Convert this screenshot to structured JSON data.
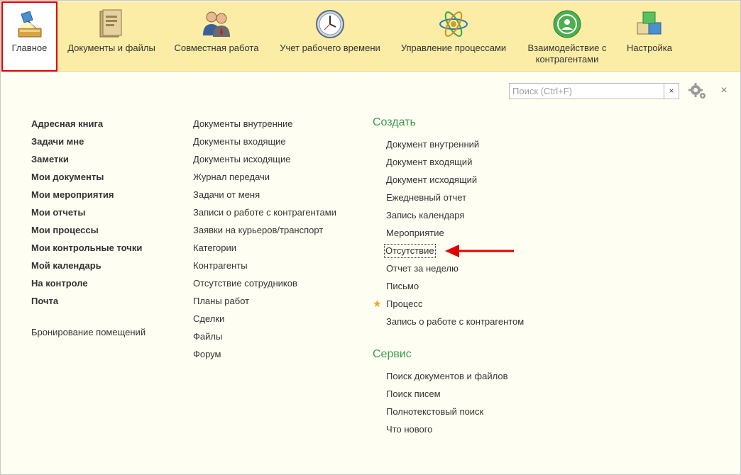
{
  "sections": [
    {
      "label": "Главное",
      "icon": "main-desk-lamp-icon",
      "active": true
    },
    {
      "label": "Документы и файлы",
      "icon": "documents-folder-icon"
    },
    {
      "label": "Совместная работа",
      "icon": "collaboration-people-icon"
    },
    {
      "label": "Учет рабочего времени",
      "icon": "clock-icon"
    },
    {
      "label": "Управление процессами",
      "icon": "process-atom-icon"
    },
    {
      "label": "Взаимодействие с",
      "label2": "контрагентами",
      "icon": "interaction-cycle-icon"
    },
    {
      "label": "Настройка",
      "icon": "settings-cubes-icon"
    }
  ],
  "search": {
    "placeholder": "Поиск (Ctrl+F)",
    "clear": "×"
  },
  "close_label": "×",
  "column1": {
    "bold_items": [
      "Адресная книга",
      "Задачи мне",
      "Заметки",
      "Мои документы",
      "Мои мероприятия",
      "Мои отчеты",
      "Мои процессы",
      "Мои контрольные точки",
      "Мой календарь",
      "На контроле",
      "Почта"
    ],
    "extra_item": "Бронирование помещений"
  },
  "column2": {
    "items": [
      "Документы внутренние",
      "Документы входящие",
      "Документы исходящие",
      "Журнал передачи",
      "Задачи от меня",
      "Записи о работе с контрагентами",
      "Заявки на курьеров/транспорт",
      "Категории",
      "Контрагенты",
      "Отсутствие сотрудников",
      "Планы работ",
      "Сделки",
      "Файлы",
      "Форум"
    ]
  },
  "create": {
    "title": "Создать",
    "items": [
      "Документ внутренний",
      "Документ входящий",
      "Документ исходящий",
      "Ежедневный отчет",
      "Запись календаря",
      "Мероприятие",
      "Отсутствие",
      "Отчет за неделю",
      "Письмо",
      "Процесс",
      "Запись о работе с контрагентом"
    ]
  },
  "service": {
    "title": "Сервис",
    "items": [
      "Поиск документов и файлов",
      "Поиск писем",
      "Полнотекстовый поиск",
      "Что нового"
    ]
  },
  "colors": {
    "accent_green": "#3a9a4f",
    "topbar": "#fbeca6",
    "highlight_red": "#e00000",
    "star": "#f0a030"
  }
}
